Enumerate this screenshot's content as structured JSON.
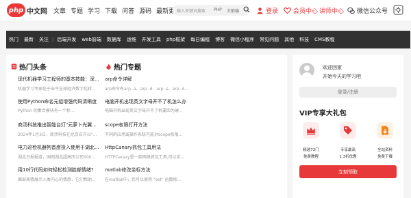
{
  "logo": {
    "badge": "php",
    "text": "中文网"
  },
  "top_nav": [
    "文章",
    "专题",
    "学习",
    "下载",
    "问答",
    "源码",
    "最新更新"
  ],
  "search": {
    "placeholder": "输入关键词搜索",
    "tag1": "PHP",
    "tag2": "大前端"
  },
  "header": {
    "login": "登录",
    "member": "会员中心",
    "instructor": "讲师中心",
    "wechat": "微信公众号"
  },
  "dark_nav": [
    "热门",
    "最新",
    "关注",
    "|",
    "后端开发",
    "web前端",
    "数据库",
    "运维",
    "开发工具",
    "php框架",
    "每日编程",
    "博客",
    "微信小程序",
    "常见问题",
    "其他",
    "科技",
    "CMS教程"
  ],
  "hot_news": {
    "heading": "热门头条",
    "items": [
      {
        "title": "现代机器学习工程师的基本技能：深...",
        "desc": "机器学习专家处于当今全球经济数字化转..."
      },
      {
        "title": "使用Python命名元组增强代码清晰度",
        "desc": "Python 的集合模块有一个称..."
      },
      {
        "title": "商汤科技推出智能台灯\"元萝卜光翼...",
        "desc": "2024年1月3日，商汤科技在北京召开以\"..."
      },
      {
        "title": "电力巡检机器狗首度投入使用于湖北...",
        "desc": "湖北日报报道，国网湖北超高压公司500..."
      },
      {
        "title": "用10行代码如何轻松检测脸部情绪?",
        "desc": "面部表情展示人类内心的情感，它们帮助..."
      }
    ]
  },
  "hot_topics": {
    "heading": "热门专题",
    "items": [
      {
        "title": "arp命令详解",
        "desc": "arp命令有arp -a、arp -d、arp -s、arp -d..."
      },
      {
        "title": "电脑开机出现英文字母开不了机怎么办",
        "desc": "电脑开机出现英文字母开不了机要因为硬..."
      },
      {
        "title": "scope权限打开方法",
        "desc": "不同的应用或操作系统可能对scope权限..."
      },
      {
        "title": "HttpCanary抓包工具用法",
        "desc": "HTTPCanary是一款网络抓包工具,可以实..."
      },
      {
        "title": "matlab修改坐标方法",
        "desc": "在matlab中，您可以使用 \"set\" 函数修..."
      }
    ]
  },
  "sidebar": {
    "welcome": "欢迎回家",
    "welcome_sub": "开始今天的学习吧",
    "login_register": "登录/注册",
    "vip_title": "VIP专享大礼包",
    "perks": [
      {
        "line1": "精选72门",
        "line2": "免费教程",
        "icon": "crown-icon"
      },
      {
        "line1": "专享最高",
        "line2": "1.3折优惠",
        "icon": "discount-tag-icon"
      },
      {
        "line1": "全站资料",
        "line2": "免费下载",
        "icon": "download-file-icon"
      }
    ],
    "claim": "立刻领取"
  },
  "colors": {
    "accent": "#e8393a",
    "nav_bg": "#313131",
    "page_bg": "#f5f5f5"
  }
}
